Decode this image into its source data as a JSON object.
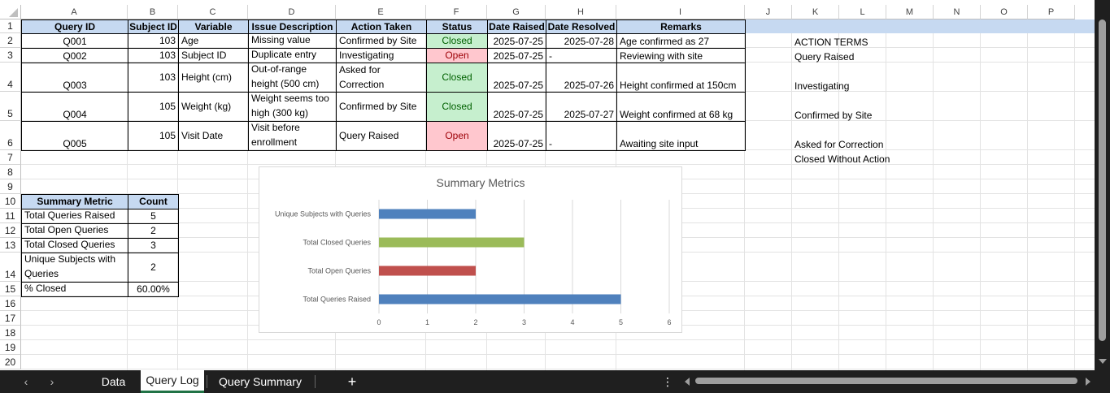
{
  "columns": [
    "A",
    "B",
    "C",
    "D",
    "E",
    "F",
    "G",
    "H",
    "I",
    "J",
    "K",
    "L",
    "M",
    "N",
    "O",
    "P"
  ],
  "rows": [
    "1",
    "2",
    "3",
    "4",
    "5",
    "6",
    "7",
    "8",
    "9",
    "10",
    "11",
    "12",
    "13",
    "14",
    "15",
    "16",
    "17",
    "18",
    "19",
    "20"
  ],
  "query_table": {
    "headers": [
      "Query ID",
      "Subject ID",
      "Variable",
      "Issue Description",
      "Action Taken",
      "Status",
      "Date Raised",
      "Date Resolved",
      "Remarks"
    ],
    "rows": [
      {
        "query_id": "Q001",
        "subject_id": "103",
        "variable": "Age",
        "issue": "Missing value",
        "action": "Confirmed by Site",
        "status": "Closed",
        "date_raised": "2025-07-25",
        "date_resolved": "2025-07-28",
        "remarks": "Age confirmed as 27"
      },
      {
        "query_id": "Q002",
        "subject_id": "103",
        "variable": "Subject ID",
        "issue": "Duplicate entry",
        "action": "Investigating",
        "status": "Open",
        "date_raised": "2025-07-25",
        "date_resolved": "-",
        "remarks": "Reviewing with site"
      },
      {
        "query_id": "Q003",
        "subject_id": "103",
        "variable": "Height (cm)",
        "issue": "Out-of-range height (500 cm)",
        "action": "Asked for Correction",
        "status": "Closed",
        "date_raised": "2025-07-25",
        "date_resolved": "2025-07-26",
        "remarks": "Height confirmed at 150cm"
      },
      {
        "query_id": "Q004",
        "subject_id": "105",
        "variable": "Weight (kg)",
        "issue": "Weight seems too high (300 kg)",
        "action": "Confirmed by Site",
        "status": "Closed",
        "date_raised": "2025-07-25",
        "date_resolved": "2025-07-27",
        "remarks": "Weight confirmed at 68 kg"
      },
      {
        "query_id": "Q005",
        "subject_id": "105",
        "variable": "Visit Date",
        "issue": "Visit before enrollment",
        "action": "Query Raised",
        "status": "Open",
        "date_raised": "2025-07-25",
        "date_resolved": "-",
        "remarks": "Awaiting site input"
      }
    ]
  },
  "action_terms": {
    "title": "ACTION TERMS",
    "items": [
      "Query Raised",
      "Investigating",
      "Confirmed by Site",
      "Asked for Correction",
      "Closed Without Action"
    ]
  },
  "summary_table": {
    "headers": [
      "Summary Metric",
      "Count"
    ],
    "rows": [
      {
        "metric": "Total Queries Raised",
        "count": "5"
      },
      {
        "metric": "Total Open Queries",
        "count": "2"
      },
      {
        "metric": "Total Closed Queries",
        "count": "3"
      },
      {
        "metric": "Unique Subjects with Queries",
        "count": "2"
      },
      {
        "metric": "% Closed",
        "count": "60.00%"
      }
    ]
  },
  "colors": {
    "header_fill": "#c6d9f1",
    "closed_fill": "#c6efce",
    "closed_text": "#006100",
    "open_fill": "#ffc7ce",
    "open_text": "#9c0006",
    "tab_accent": "#217346"
  },
  "chart_data": {
    "type": "bar",
    "orientation": "horizontal",
    "title": "Summary Metrics",
    "categories": [
      "Total Queries Raised",
      "Total Open Queries",
      "Total Closed Queries",
      "Unique Subjects with Queries"
    ],
    "values": [
      5,
      2,
      3,
      2
    ],
    "bar_colors": [
      "#4f81bd",
      "#c0504d",
      "#9bbb59",
      "#4f81bd"
    ],
    "xlim": [
      0,
      6
    ],
    "xticks": [
      "0",
      "1",
      "2",
      "3",
      "4",
      "5",
      "6"
    ],
    "grid": true,
    "legend": "none"
  },
  "tabs": {
    "prev_icon": "‹",
    "next_icon": "›",
    "items": [
      {
        "label": "Data",
        "active": false
      },
      {
        "label": "Query Log",
        "active": true
      },
      {
        "label": "Query Summary",
        "active": false
      }
    ],
    "add_icon": "+",
    "more_icon": "⋮"
  }
}
